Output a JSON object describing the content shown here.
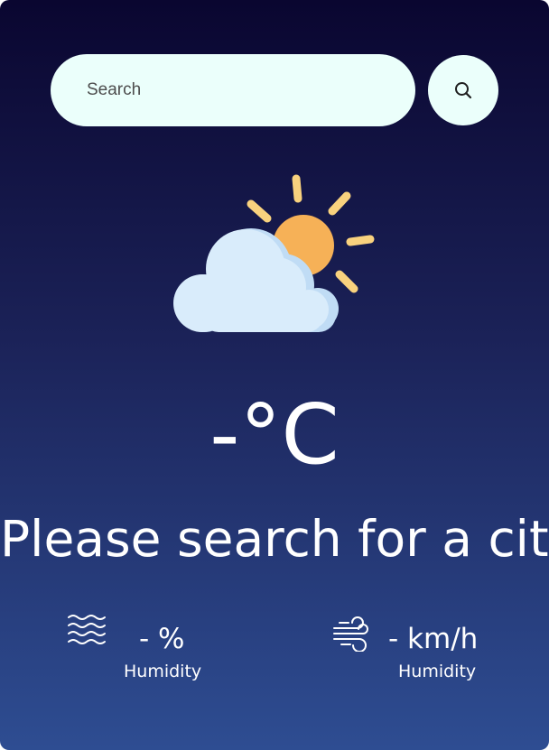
{
  "search": {
    "placeholder": "Search",
    "button_icon": "search-icon"
  },
  "weather": {
    "icon": "sun-behind-cloud-icon",
    "temperature": "-°C",
    "city": "Please search for a city"
  },
  "details": {
    "humidity": {
      "icon": "water-waves-icon",
      "value": "- %",
      "label": "Humidity"
    },
    "wind": {
      "icon": "wind-icon",
      "value": "- km/h",
      "label": "Humidity"
    }
  },
  "colors": {
    "gradient_top": "#0a0630",
    "gradient_bottom": "#2e4d92",
    "search_bg": "#ebfffb",
    "sun": "#f6b157",
    "sun_rays": "#f9d27e",
    "cloud": "#d9ecfb",
    "cloud_shade": "#c0dcf5"
  }
}
